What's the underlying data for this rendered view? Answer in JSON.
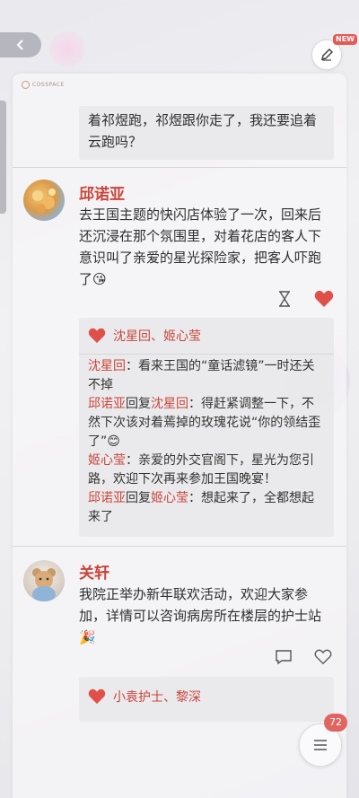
{
  "header": {
    "logo_text": "COSSPACE",
    "new_badge": "NEW"
  },
  "thread": {
    "prev_reply_tail": "着祁煜跑，祁煜跟你走了，我还要追着云跑吗？",
    "posts": [
      {
        "author": "邱诺亚",
        "text": "去王国主题的快闪店体验了一次，回来后还沉浸在那个氛围里，对着花店的客人下意识叫了亲爱的星光探险家，把客人吓跑了😘",
        "likes": "沈星回、姬心莹",
        "replies": [
          {
            "from": "沈星回",
            "sep": "：",
            "to": "",
            "text": "看来王国的“童话滤镜”一时还关不掉"
          },
          {
            "from": "邱诺亚",
            "sep": "回复",
            "to": "沈星回",
            "text": "：得赶紧调整一下，不然下次该对着蔫掉的玫瑰花说“你的领结歪了”😊"
          },
          {
            "from": "姬心莹",
            "sep": "：",
            "to": "",
            "text": "亲爱的外交官阁下，星光为您引路，欢迎下次再来参加王国晚宴！"
          },
          {
            "from": "邱诺亚",
            "sep": "回复",
            "to": "姬心莹",
            "text": "：想起来了，全都想起来了"
          }
        ]
      },
      {
        "author": "关轩",
        "text": "我院正举办新年联欢活动，欢迎大家参加，详情可以咨询病房所在楼层的护士站🎉",
        "likes": "小袁护士、黎深"
      }
    ]
  },
  "footer": {
    "comment_count": "72"
  },
  "icons": {
    "back": "chevron-left-icon",
    "edit": "pencil-icon",
    "hourglass": "hourglass-icon",
    "heart": "heart-icon",
    "comment": "comment-icon",
    "menu": "menu-icon"
  },
  "colors": {
    "accent": "#c9453b",
    "heart": "#e0504a",
    "badge": "#e06560"
  }
}
